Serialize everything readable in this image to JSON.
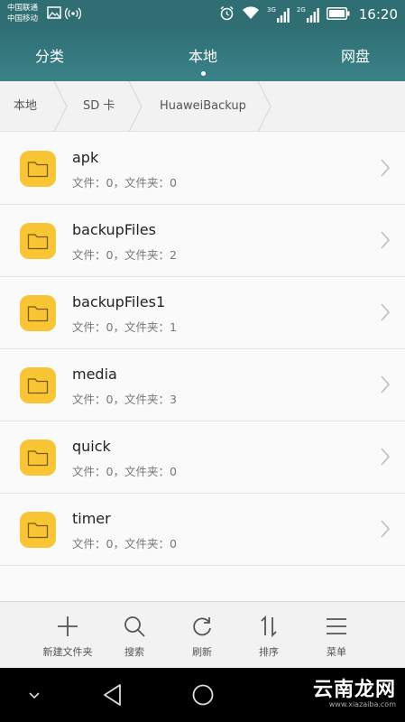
{
  "status_bar": {
    "carrier_1": "中国联通",
    "carrier_2": "中国移动",
    "network_1": "3G",
    "network_2": "2G",
    "time": "16:20"
  },
  "tabs": [
    {
      "label": "分类"
    },
    {
      "label": "本地"
    },
    {
      "label": "网盘"
    }
  ],
  "breadcrumb": [
    "本地",
    "SD 卡",
    "HuaweiBackup"
  ],
  "files": [
    {
      "name": "apk",
      "meta": "文件：0，文件夹：0"
    },
    {
      "name": "backupFiles",
      "meta": "文件：0，文件夹：2"
    },
    {
      "name": "backupFiles1",
      "meta": "文件：0，文件夹：1"
    },
    {
      "name": "media",
      "meta": "文件：0，文件夹：3"
    },
    {
      "name": "quick",
      "meta": "文件：0，文件夹：0"
    },
    {
      "name": "timer",
      "meta": "文件：0，文件夹：0"
    }
  ],
  "toolbar": {
    "new_folder": "新建文件夹",
    "search": "搜索",
    "refresh": "刷新",
    "sort": "排序",
    "menu": "菜单"
  },
  "watermark": {
    "text": "云南龙网",
    "url": "www.xiazaiba.com"
  },
  "colors": {
    "header": "#2f6f73",
    "folder": "#f9c535"
  }
}
